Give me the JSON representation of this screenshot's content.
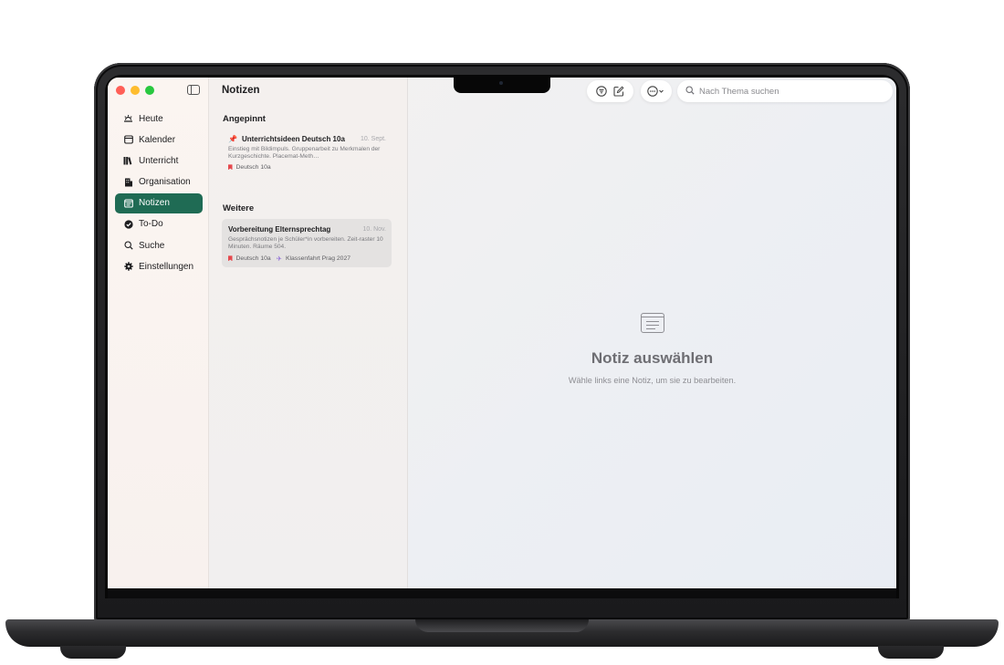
{
  "sidebar": {
    "items": [
      {
        "label": "Heute",
        "icon": "sun-horizon-icon"
      },
      {
        "label": "Kalender",
        "icon": "calendar-icon"
      },
      {
        "label": "Unterricht",
        "icon": "books-icon"
      },
      {
        "label": "Organisation",
        "icon": "building-icon"
      },
      {
        "label": "Notizen",
        "icon": "note-icon",
        "active": true
      },
      {
        "label": "To-Do",
        "icon": "checkmark-circle-icon"
      },
      {
        "label": "Suche",
        "icon": "search-icon"
      },
      {
        "label": "Einstellungen",
        "icon": "gear-icon"
      }
    ]
  },
  "list": {
    "title": "Notizen",
    "pinned_heading": "Angepinnt",
    "other_heading": "Weitere",
    "pinned_notes": [
      {
        "title": "Unterrichtsideen Deutsch 10a",
        "date": "10. Sept.",
        "preview": "Einstieg mit Bildimpuls. Gruppenarbeit zu Merkmalen der Kurzgeschichte. Placemat-Meth…",
        "tags": [
          "Deutsch 10a"
        ]
      }
    ],
    "other_notes": [
      {
        "title": "Vorbereitung Elternsprechtag",
        "date": "10. Nov.",
        "preview": "Gesprächsnotizen je Schüler*in vorbereiten. Zeit-raster 10 Minuten. Räume 504.",
        "tags": [
          "Deutsch 10a",
          "Klassenfahrt Prag 2027"
        ]
      }
    ]
  },
  "toolbar": {
    "search_placeholder": "Nach Thema suchen",
    "icons": [
      "filter-icon",
      "compose-icon",
      "more-icon"
    ]
  },
  "detail": {
    "empty_title": "Notiz auswählen",
    "empty_subtitle": "Wähle links eine Notiz, um sie zu bearbeiten."
  },
  "colors": {
    "accent": "#1f6b54",
    "tag_red": "#e5484d",
    "pin_orange": "#f08a24",
    "tag_purple": "#8e6bd8"
  }
}
